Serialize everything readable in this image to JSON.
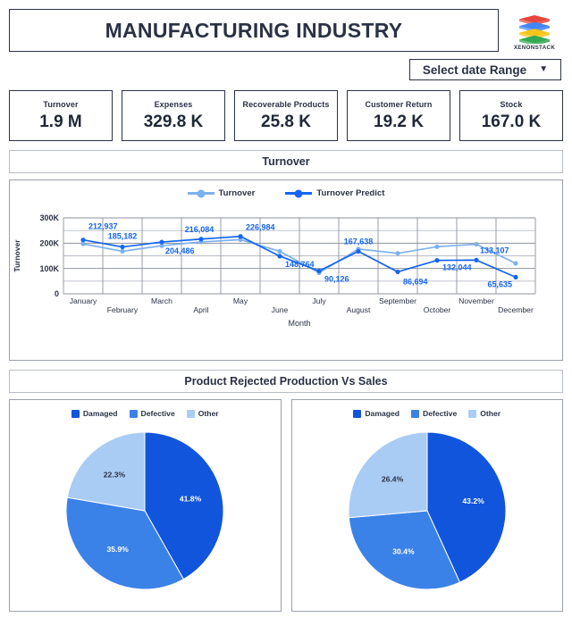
{
  "header": {
    "title": "MANUFACTURING INDUSTRY",
    "logo_text": "XENONSTACK",
    "logo_icon": "xenonstack-stack-logo",
    "logo_colors": [
      "#e8463c",
      "#4285f4",
      "#f5c518",
      "#34a853"
    ]
  },
  "date_range": {
    "label": "Select date Range",
    "caret_icon": "chevron-down-icon"
  },
  "kpis": [
    {
      "label": "Turnover",
      "value": "1.9 M"
    },
    {
      "label": "Expenses",
      "value": "329.8 K"
    },
    {
      "label": "Recoverable Products",
      "value": "25.8 K"
    },
    {
      "label": "Customer Return",
      "value": "19.2 K"
    },
    {
      "label": "Stock",
      "value": "167.0 K"
    }
  ],
  "sections": {
    "turnover_title": "Turnover",
    "rejected_title": "Product Rejected Production Vs Sales"
  },
  "colors": {
    "turnover": "#7cb1ef",
    "turnover_predict": "#1565f0",
    "pie_damaged": "#1155dd",
    "pie_defective": "#3b82e8",
    "pie_other": "#a9ccf5",
    "ink": "#2b3245",
    "grid": "#9aa0ad"
  },
  "chart_data": [
    {
      "type": "line",
      "title": "Turnover",
      "xlabel": "Month",
      "ylabel": "Turnover",
      "ylim": [
        0,
        300000
      ],
      "yticks": [
        0,
        100000,
        200000,
        300000
      ],
      "ytick_labels": [
        "0",
        "100K",
        "200K",
        "300K"
      ],
      "grid": true,
      "legend_position": "top-center",
      "categories": [
        "January",
        "February",
        "March",
        "April",
        "May",
        "June",
        "July",
        "August",
        "September",
        "October",
        "November",
        "December"
      ],
      "series": [
        {
          "name": "Turnover",
          "color": "#7cb1ef",
          "values": [
            197000,
            168000,
            190000,
            205000,
            214000,
            168000,
            83000,
            177000,
            160000,
            186000,
            196000,
            120000
          ]
        },
        {
          "name": "Turnover Predict",
          "color": "#1565f0",
          "values": [
            212937,
            185182,
            204486,
            216084,
            226984,
            148764,
            90126,
            167638,
            86694,
            132044,
            133107,
            65635
          ]
        }
      ],
      "point_labels": [
        {
          "index": 0,
          "text": "212,937"
        },
        {
          "index": 1,
          "text": "185,182"
        },
        {
          "index": 2,
          "text": "204,486"
        },
        {
          "index": 3,
          "text": "216,084"
        },
        {
          "index": 4,
          "text": "226,984"
        },
        {
          "index": 5,
          "text": "148,764"
        },
        {
          "index": 6,
          "text": "90,126"
        },
        {
          "index": 7,
          "text": "167,638"
        },
        {
          "index": 8,
          "text": "86,694"
        },
        {
          "index": 9,
          "text": "132,044"
        },
        {
          "index": 10,
          "text": "133,107"
        },
        {
          "index": 11,
          "text": "65,635"
        }
      ]
    },
    {
      "type": "pie",
      "title": "Product Rejected Production",
      "labels": [
        "Damaged",
        "Defective",
        "Other"
      ],
      "values": [
        41.8,
        35.9,
        22.3
      ],
      "value_labels": [
        "41.8%",
        "35.9%",
        "22.3%"
      ],
      "colors": [
        "#1155dd",
        "#3b82e8",
        "#a9ccf5"
      ],
      "legend_position": "top-center"
    },
    {
      "type": "pie",
      "title": "Sales",
      "labels": [
        "Damaged",
        "Defective",
        "Other"
      ],
      "values": [
        43.2,
        30.4,
        26.4
      ],
      "value_labels": [
        "43.2%",
        "30.4%",
        "26.4%"
      ],
      "colors": [
        "#1155dd",
        "#3b82e8",
        "#a9ccf5"
      ],
      "legend_position": "top-center"
    }
  ]
}
